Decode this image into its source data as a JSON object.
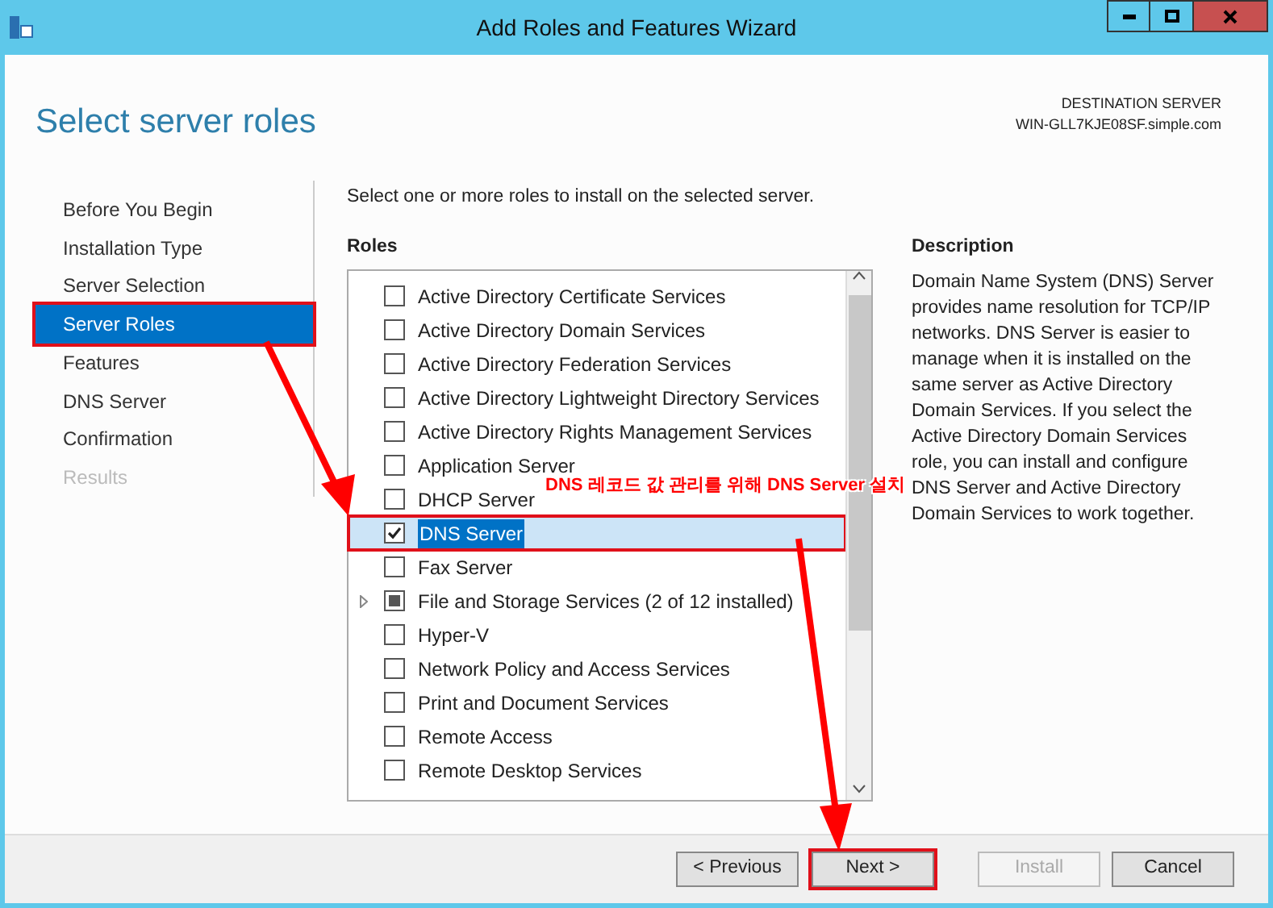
{
  "window": {
    "title": "Add Roles and Features Wizard"
  },
  "page_title": "Select server roles",
  "destination": {
    "label": "DESTINATION SERVER",
    "server": "WIN-GLL7KJE08SF.simple.com"
  },
  "sidebar": {
    "items": [
      {
        "label": "Before You Begin",
        "selected": false,
        "disabled": false
      },
      {
        "label": "Installation Type",
        "selected": false,
        "disabled": false
      },
      {
        "label": "Server Selection",
        "selected": false,
        "disabled": false
      },
      {
        "label": "Server Roles",
        "selected": true,
        "disabled": false
      },
      {
        "label": "Features",
        "selected": false,
        "disabled": false
      },
      {
        "label": "DNS Server",
        "selected": false,
        "disabled": false
      },
      {
        "label": "Confirmation",
        "selected": false,
        "disabled": false
      },
      {
        "label": "Results",
        "selected": false,
        "disabled": true
      }
    ]
  },
  "instruction": "Select one or more roles to install on the selected server.",
  "roles": {
    "heading": "Roles",
    "items": [
      {
        "label": "Active Directory Certificate Services",
        "checked": false,
        "partial": false,
        "selected": false,
        "expandable": false
      },
      {
        "label": "Active Directory Domain Services",
        "checked": false,
        "partial": false,
        "selected": false,
        "expandable": false
      },
      {
        "label": "Active Directory Federation Services",
        "checked": false,
        "partial": false,
        "selected": false,
        "expandable": false
      },
      {
        "label": "Active Directory Lightweight Directory Services",
        "checked": false,
        "partial": false,
        "selected": false,
        "expandable": false
      },
      {
        "label": "Active Directory Rights Management Services",
        "checked": false,
        "partial": false,
        "selected": false,
        "expandable": false
      },
      {
        "label": "Application Server",
        "checked": false,
        "partial": false,
        "selected": false,
        "expandable": false
      },
      {
        "label": "DHCP Server",
        "checked": false,
        "partial": false,
        "selected": false,
        "expandable": false
      },
      {
        "label": "DNS Server",
        "checked": true,
        "partial": false,
        "selected": true,
        "expandable": false
      },
      {
        "label": "Fax Server",
        "checked": false,
        "partial": false,
        "selected": false,
        "expandable": false
      },
      {
        "label": "File and Storage Services (2 of 12 installed)",
        "checked": false,
        "partial": true,
        "selected": false,
        "expandable": true
      },
      {
        "label": "Hyper-V",
        "checked": false,
        "partial": false,
        "selected": false,
        "expandable": false
      },
      {
        "label": "Network Policy and Access Services",
        "checked": false,
        "partial": false,
        "selected": false,
        "expandable": false
      },
      {
        "label": "Print and Document Services",
        "checked": false,
        "partial": false,
        "selected": false,
        "expandable": false
      },
      {
        "label": "Remote Access",
        "checked": false,
        "partial": false,
        "selected": false,
        "expandable": false
      },
      {
        "label": "Remote Desktop Services",
        "checked": false,
        "partial": false,
        "selected": false,
        "expandable": false
      }
    ]
  },
  "description": {
    "heading": "Description",
    "text": "Domain Name System (DNS) Server provides name resolution for TCP/IP networks. DNS Server is easier to manage when it is installed on the same server as Active Directory Domain Services. If you select the Active Directory Domain Services role, you can install and configure DNS Server and Active Directory Domain Services to work together."
  },
  "buttons": [
    {
      "label": "< Previous",
      "disabled": false,
      "highlighted": false
    },
    {
      "label": "Next >",
      "disabled": false,
      "highlighted": true
    },
    {
      "label": "Install",
      "disabled": true,
      "highlighted": false
    },
    {
      "label": "Cancel",
      "disabled": false,
      "highlighted": false
    }
  ],
  "annotation": {
    "text": "DNS 레코드 값 관리를 위해 DNS Server 설치"
  }
}
